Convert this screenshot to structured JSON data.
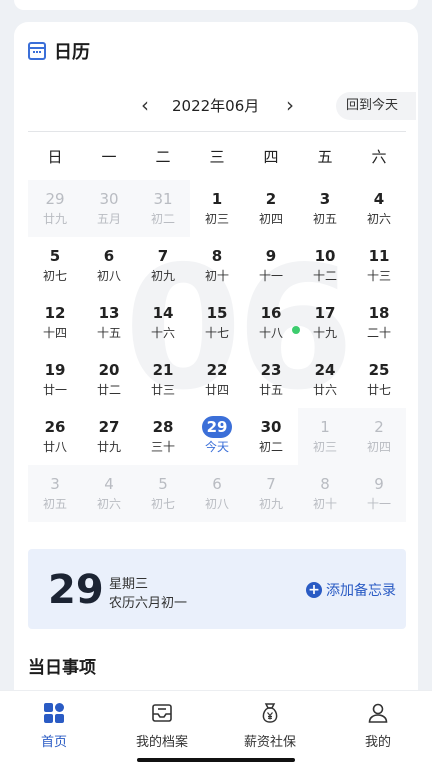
{
  "calendar": {
    "title": "日历",
    "month_label": "2022年06月",
    "today_button": "回到今天",
    "watermark": "06",
    "weekdays": [
      "日",
      "一",
      "二",
      "三",
      "四",
      "五",
      "六"
    ],
    "weeks": [
      [
        {
          "d": "29",
          "l": "廿九",
          "o": true
        },
        {
          "d": "30",
          "l": "五月",
          "o": true
        },
        {
          "d": "31",
          "l": "初二",
          "o": true
        },
        {
          "d": "1",
          "l": "初三"
        },
        {
          "d": "2",
          "l": "初四"
        },
        {
          "d": "3",
          "l": "初五"
        },
        {
          "d": "4",
          "l": "初六"
        }
      ],
      [
        {
          "d": "5",
          "l": "初七"
        },
        {
          "d": "6",
          "l": "初八"
        },
        {
          "d": "7",
          "l": "初九"
        },
        {
          "d": "8",
          "l": "初十"
        },
        {
          "d": "9",
          "l": "十一"
        },
        {
          "d": "10",
          "l": "十二"
        },
        {
          "d": "11",
          "l": "十三"
        }
      ],
      [
        {
          "d": "12",
          "l": "十四"
        },
        {
          "d": "13",
          "l": "十五"
        },
        {
          "d": "14",
          "l": "十六"
        },
        {
          "d": "15",
          "l": "十七"
        },
        {
          "d": "16",
          "l": "十八",
          "dot": true
        },
        {
          "d": "17",
          "l": "十九"
        },
        {
          "d": "18",
          "l": "二十"
        }
      ],
      [
        {
          "d": "19",
          "l": "廿一"
        },
        {
          "d": "20",
          "l": "廿二"
        },
        {
          "d": "21",
          "l": "廿三"
        },
        {
          "d": "22",
          "l": "廿四"
        },
        {
          "d": "23",
          "l": "廿五"
        },
        {
          "d": "24",
          "l": "廿六"
        },
        {
          "d": "25",
          "l": "廿七"
        }
      ],
      [
        {
          "d": "26",
          "l": "廿八"
        },
        {
          "d": "27",
          "l": "廿九"
        },
        {
          "d": "28",
          "l": "三十"
        },
        {
          "d": "29",
          "l": "今天",
          "today": true
        },
        {
          "d": "30",
          "l": "初二"
        },
        {
          "d": "1",
          "l": "初三",
          "o": true
        },
        {
          "d": "2",
          "l": "初四",
          "o": true
        }
      ],
      [
        {
          "d": "3",
          "l": "初五",
          "o": true
        },
        {
          "d": "4",
          "l": "初六",
          "o": true
        },
        {
          "d": "5",
          "l": "初七",
          "o": true
        },
        {
          "d": "6",
          "l": "初八",
          "o": true
        },
        {
          "d": "7",
          "l": "初九",
          "o": true
        },
        {
          "d": "8",
          "l": "初十",
          "o": true
        },
        {
          "d": "9",
          "l": "十一",
          "o": true
        }
      ]
    ]
  },
  "selected": {
    "day": "29",
    "weekday": "星期三",
    "lunar": "农历六月初一",
    "add_memo": "添加备忘录"
  },
  "section": {
    "title": "当日事项"
  },
  "tabs": [
    {
      "label": "首页",
      "icon": "home-grid-icon",
      "active": true
    },
    {
      "label": "我的档案",
      "icon": "inbox-tray-icon"
    },
    {
      "label": "薪资社保",
      "icon": "money-bag-icon"
    },
    {
      "label": "我的",
      "icon": "person-icon"
    }
  ],
  "colors": {
    "accent": "#3b6fd8",
    "event_dot": "#3dcc6e"
  }
}
